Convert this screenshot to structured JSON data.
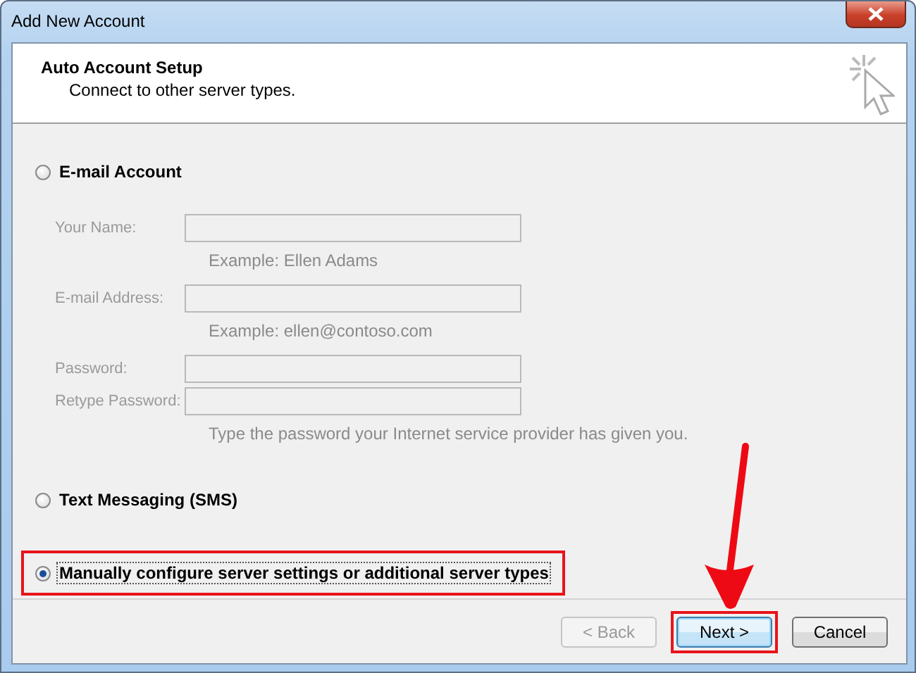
{
  "window": {
    "title": "Add New Account"
  },
  "header": {
    "title": "Auto Account Setup",
    "subtitle": "Connect to other server types."
  },
  "options": [
    {
      "kind": "form",
      "label": "E-mail Account",
      "selected": false,
      "fields": [
        {
          "label": "Your Name:",
          "hint": "Example: Ellen Adams",
          "disabled": true
        },
        {
          "label": "E-mail Address:",
          "hint": "Example: ellen@contoso.com",
          "disabled": true
        },
        {
          "label": "Password:",
          "disabled": true
        },
        {
          "label": "Retype Password:",
          "hint": "Type the password your Internet service provider has given you.",
          "disabled": true
        }
      ]
    },
    {
      "kind": "plain",
      "label": "Text Messaging (SMS)",
      "selected": false
    },
    {
      "kind": "plain",
      "label": "Manually configure server settings or additional server types",
      "selected": true,
      "highlighted": true,
      "focused": true
    }
  ],
  "buttons": [
    {
      "label": "< Back",
      "disabled": true,
      "default": false
    },
    {
      "label": "Next >",
      "disabled": false,
      "default": true,
      "highlighted": true,
      "arrow": true
    },
    {
      "label": "Cancel",
      "disabled": false,
      "default": false
    }
  ]
}
